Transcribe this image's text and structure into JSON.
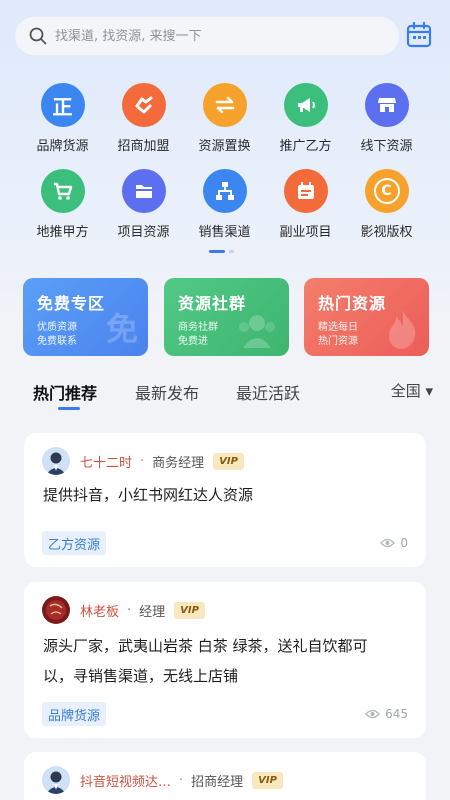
{
  "search": {
    "placeholder": "找渠道, 找资源, 来搜一下"
  },
  "grid": [
    {
      "label": "品牌货源",
      "icon": "brand-icon",
      "color": "#3b86f0",
      "glyph": "正"
    },
    {
      "label": "招商加盟",
      "icon": "handshake-icon",
      "color": "#f36b3b"
    },
    {
      "label": "资源置换",
      "icon": "swap-icon",
      "color": "#f7a22c"
    },
    {
      "label": "推广乙方",
      "icon": "megaphone-icon",
      "color": "#3cbf7c"
    },
    {
      "label": "线下资源",
      "icon": "store-icon",
      "color": "#5c6ff0"
    },
    {
      "label": "地推甲方",
      "icon": "cart-icon",
      "color": "#3cbf7c"
    },
    {
      "label": "项目资源",
      "icon": "folder-icon",
      "color": "#5c6ff0"
    },
    {
      "label": "销售渠道",
      "icon": "hierarchy-icon",
      "color": "#3b86f0"
    },
    {
      "label": "副业项目",
      "icon": "calendar-board-icon",
      "color": "#f36b3b"
    },
    {
      "label": "影视版权",
      "icon": "copyright-icon",
      "color": "#f7a22c",
      "glyph": "C"
    }
  ],
  "promos": [
    {
      "title": "免费专区",
      "sub1": "优质资源",
      "sub2": "免费联系",
      "watermark": "免",
      "color": "#5c93f5"
    },
    {
      "title": "资源社群",
      "sub1": "商务社群",
      "sub2": "免费进",
      "color": "#49c07b"
    },
    {
      "title": "热门资源",
      "sub1": "精选每日",
      "sub2": "热门资源",
      "color": "#f06a5f"
    }
  ],
  "tabs": {
    "hot": "热门推荐",
    "latest": "最新发布",
    "active": "最近活跃",
    "region": "全国 ▾"
  },
  "cards": [
    {
      "author": "七十二时",
      "sep": "·",
      "role": "商务经理",
      "vip": "VIP",
      "line1": "提供抖音，小红书网红达人资源",
      "line2": "",
      "tag": "乙方资源",
      "views": "0"
    },
    {
      "author": "林老板",
      "sep": "·",
      "role": "经理",
      "vip": "VIP",
      "line1": "源头厂家，武夷山岩茶 白茶 绿茶，送礼自饮都可",
      "line2": "以，寻销售渠道，无线上店铺",
      "tag": "品牌货源",
      "views": "645"
    },
    {
      "author": "抖音短视频达…",
      "sep": "·",
      "role": "招商经理",
      "vip": "VIP"
    }
  ]
}
